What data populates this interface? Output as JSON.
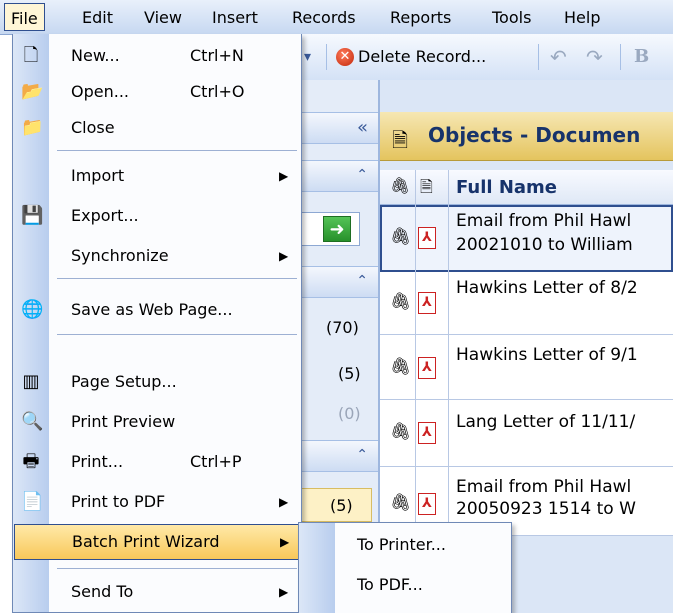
{
  "menubar": {
    "items": [
      "File",
      "Edit",
      "View",
      "Insert",
      "Records",
      "Reports",
      "Tools",
      "Help"
    ]
  },
  "toolbar": {
    "delete_label": "Delete Record...",
    "extra_glyph": "B"
  },
  "left_pane": {
    "collapse_glyph": "«",
    "chevron_glyph": "⌃",
    "counts": [
      "(70)",
      "(5)",
      "(0)",
      "(5)"
    ]
  },
  "objects_panel": {
    "title": "Objects - Documen",
    "column_full_name": "Full Name",
    "rows": [
      {
        "line1": "Email from Phil Hawl",
        "line2": "20021010 to William"
      },
      {
        "line1": "Hawkins Letter of 8/2",
        "line2": ""
      },
      {
        "line1": "Hawkins Letter of 9/1",
        "line2": ""
      },
      {
        "line1": "Lang Letter of 11/11/",
        "line2": ""
      },
      {
        "line1": "Email from Phil Hawl",
        "line2": "20050923 1514 to W"
      }
    ]
  },
  "file_menu": {
    "items": [
      {
        "label": "New...",
        "shortcut": "Ctrl+N",
        "icon": "new-document-icon",
        "glyph": "🗋"
      },
      {
        "label": "Open...",
        "shortcut": "Ctrl+O",
        "icon": "open-folder-icon",
        "glyph": "📂"
      },
      {
        "label": "Close",
        "shortcut": "",
        "icon": "close-folder-icon",
        "glyph": "📁"
      },
      {
        "label": "Import",
        "shortcut": "",
        "icon": "",
        "glyph": ""
      },
      {
        "label": "Export...",
        "shortcut": "",
        "icon": "export-icon",
        "glyph": "💾"
      },
      {
        "label": "Synchronize",
        "shortcut": "",
        "icon": "",
        "glyph": ""
      },
      {
        "label": "Save as Web Page...",
        "shortcut": "",
        "icon": "web-page-icon",
        "glyph": "🌐"
      },
      {
        "label": "Page Setup...",
        "shortcut": "",
        "icon": "page-setup-icon",
        "glyph": "▥"
      },
      {
        "label": "Print Preview",
        "shortcut": "",
        "icon": "print-preview-icon",
        "glyph": "🔍"
      },
      {
        "label": "Print...",
        "shortcut": "Ctrl+P",
        "icon": "printer-icon",
        "glyph": "🖶"
      },
      {
        "label": "Print to PDF",
        "shortcut": "",
        "icon": "pdf-print-icon",
        "glyph": "📄"
      },
      {
        "label": "Batch Print Wizard",
        "shortcut": "",
        "icon": "",
        "glyph": ""
      },
      {
        "label": "Send To",
        "shortcut": "",
        "icon": "",
        "glyph": ""
      }
    ],
    "arrow_glyph": "▶"
  },
  "submenu": {
    "items": [
      "To Printer...",
      "To PDF..."
    ]
  }
}
